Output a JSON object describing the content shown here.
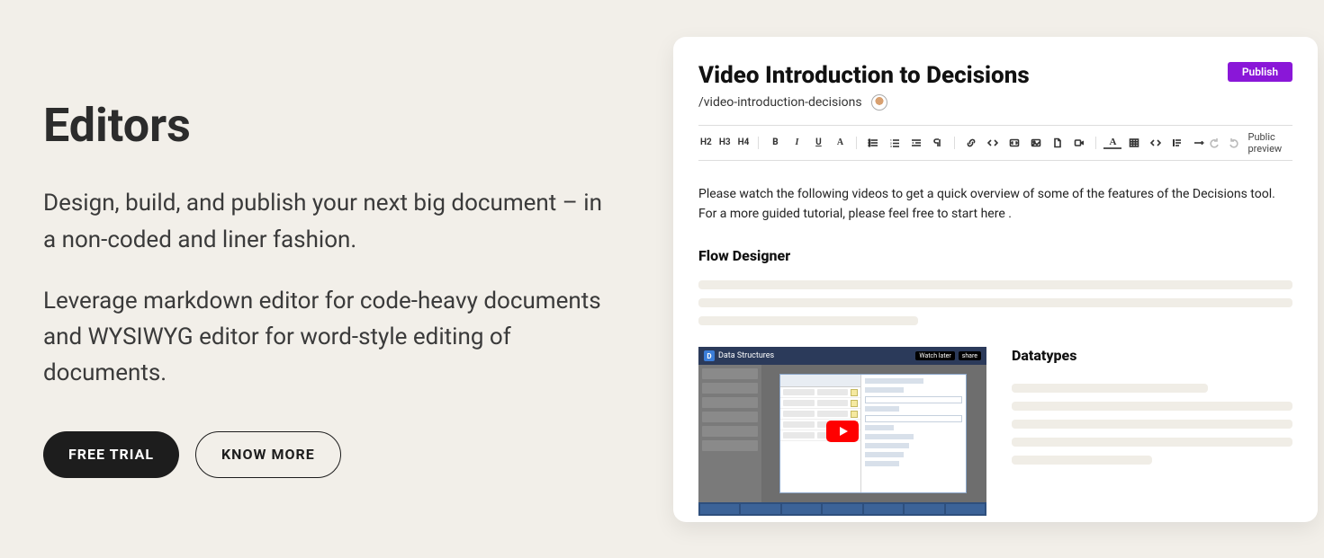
{
  "hero": {
    "title": "Editors",
    "para1": "Design, build, and publish your next big document – in a non-coded and liner fashion.",
    "para2": "Leverage markdown editor for code-heavy documents and WYSIWYG editor for word-style editing of documents.",
    "cta_primary": "FREE TRIAL",
    "cta_secondary": "KNOW MORE"
  },
  "editor": {
    "title": "Video Introduction to Decisions",
    "slug": "/video-introduction-decisions",
    "publish_label": "Publish",
    "public_preview_label": "Public preview",
    "toolbar": {
      "h2": "H2",
      "h3": "H3",
      "h4": "H4",
      "bold": "B",
      "italic": "I",
      "underline": "U",
      "font": "A",
      "color": "A"
    },
    "body": "Please watch the following videos to get a quick overview of some of the features of the Decisions tool. For a more guided tutorial, please feel free to start here .",
    "section1_title": "Flow Designer",
    "section2_title": "Datatypes",
    "video": {
      "provider_badge": "D",
      "title": "Data Structures",
      "watch_later": "Watch later",
      "share": "share"
    }
  }
}
